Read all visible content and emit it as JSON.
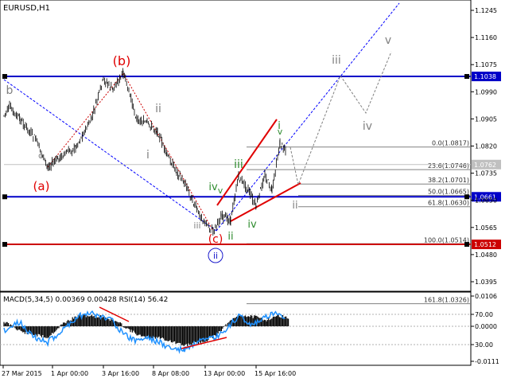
{
  "window": {
    "title": "EURUSD,H1"
  },
  "main_chart": {
    "price_axis": [
      "1.1245",
      "1.1160",
      "1.1075",
      "1.0990",
      "1.0905",
      "1.0820",
      "1.0735",
      "1.0650",
      "1.0565",
      "1.0480",
      "1.0395"
    ],
    "fib_levels": [
      {
        "label": "0.0(1.0817)"
      },
      {
        "label": "23.6(1.0746)"
      },
      {
        "label": "38.2(1.0701)"
      },
      {
        "label": "50.0(1.0665)"
      },
      {
        "label": "61.8(1.0630)"
      },
      {
        "label": "100.0(1.0514)"
      },
      {
        "label": "161.8(1.0326)"
      }
    ],
    "hlines": [
      {
        "price": "1.1038",
        "color": "#0000c8"
      },
      {
        "price": "1.0661",
        "color": "#0000c8"
      },
      {
        "price": "1.0512",
        "color": "#cc0000"
      }
    ],
    "current_price": "1.0762",
    "wave_labels": [
      {
        "text": "(b)",
        "color": "#e00000"
      },
      {
        "text": "(a)",
        "color": "#e00000"
      },
      {
        "text": "(c)",
        "color": "#e00000"
      },
      {
        "text": "b",
        "color": "#808080"
      },
      {
        "text": "c",
        "color": "#808080"
      },
      {
        "text": "ii",
        "color": "#808080"
      },
      {
        "text": "i",
        "color": "#808080"
      },
      {
        "text": "iii",
        "color": "#808080"
      },
      {
        "text": "iv",
        "color": "#2e8b2e"
      },
      {
        "text": "v",
        "color": "#2e8b2e"
      },
      {
        "text": "ii",
        "color": "#2e8b2e"
      },
      {
        "text": "iii",
        "color": "#2e8b2e"
      },
      {
        "text": "iv",
        "color": "#2e8b2e"
      },
      {
        "text": "i",
        "color": "#2e8b2e"
      },
      {
        "text": "v",
        "color": "#2e8b2e"
      },
      {
        "text": "ii",
        "color": "#1a1acc"
      },
      {
        "text": "ii",
        "color": "#808080"
      },
      {
        "text": "iii",
        "color": "#808080"
      },
      {
        "text": "iv",
        "color": "#808080"
      },
      {
        "text": "v",
        "color": "#808080"
      }
    ]
  },
  "indicator": {
    "title": "MACD(5,34,5) 0.00369 0.00428 RSI(14) 56.42",
    "axis_right": [
      "0.0106",
      "70.00",
      "0.0000",
      "30.00",
      "-0.0111"
    ]
  },
  "time_axis": [
    "27 Mar 2015",
    "1 Apr 00:00",
    "3 Apr 16:00",
    "8 Apr 08:00",
    "13 Apr 00:00",
    "15 Apr 16:00"
  ],
  "colors": {
    "candles": "#000000",
    "blue_level": "#0000c8",
    "red_level": "#cc0000",
    "fib": "#808080",
    "rsi": "#1e90ff",
    "macd_hist": "#000000",
    "forecast_blue": "#0000ff",
    "forecast_gray": "#808080"
  }
}
